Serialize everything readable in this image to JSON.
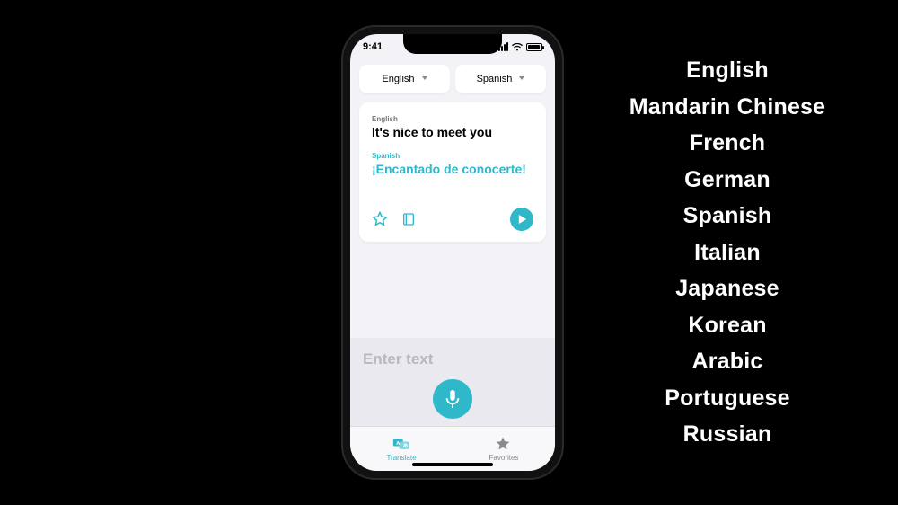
{
  "status": {
    "time": "9:41"
  },
  "selector": {
    "source_label": "English",
    "target_label": "Spanish"
  },
  "card": {
    "source_lang": "English",
    "source_text": "It's nice to meet you",
    "target_lang": "Spanish",
    "target_text": "¡Encantado de conocerte!"
  },
  "icons": {
    "favorite": "star-icon",
    "dictionary": "book-icon",
    "play": "play-icon"
  },
  "input": {
    "placeholder": "Enter text"
  },
  "tabs": {
    "translate": "Translate",
    "favorites": "Favorites"
  },
  "languages": [
    "English",
    "Mandarin Chinese",
    "French",
    "German",
    "Spanish",
    "Italian",
    "Japanese",
    "Korean",
    "Arabic",
    "Portuguese",
    "Russian"
  ],
  "colors": {
    "accent": "#2eb8c9",
    "bg": "#000000",
    "screen": "#f2f2f7"
  }
}
